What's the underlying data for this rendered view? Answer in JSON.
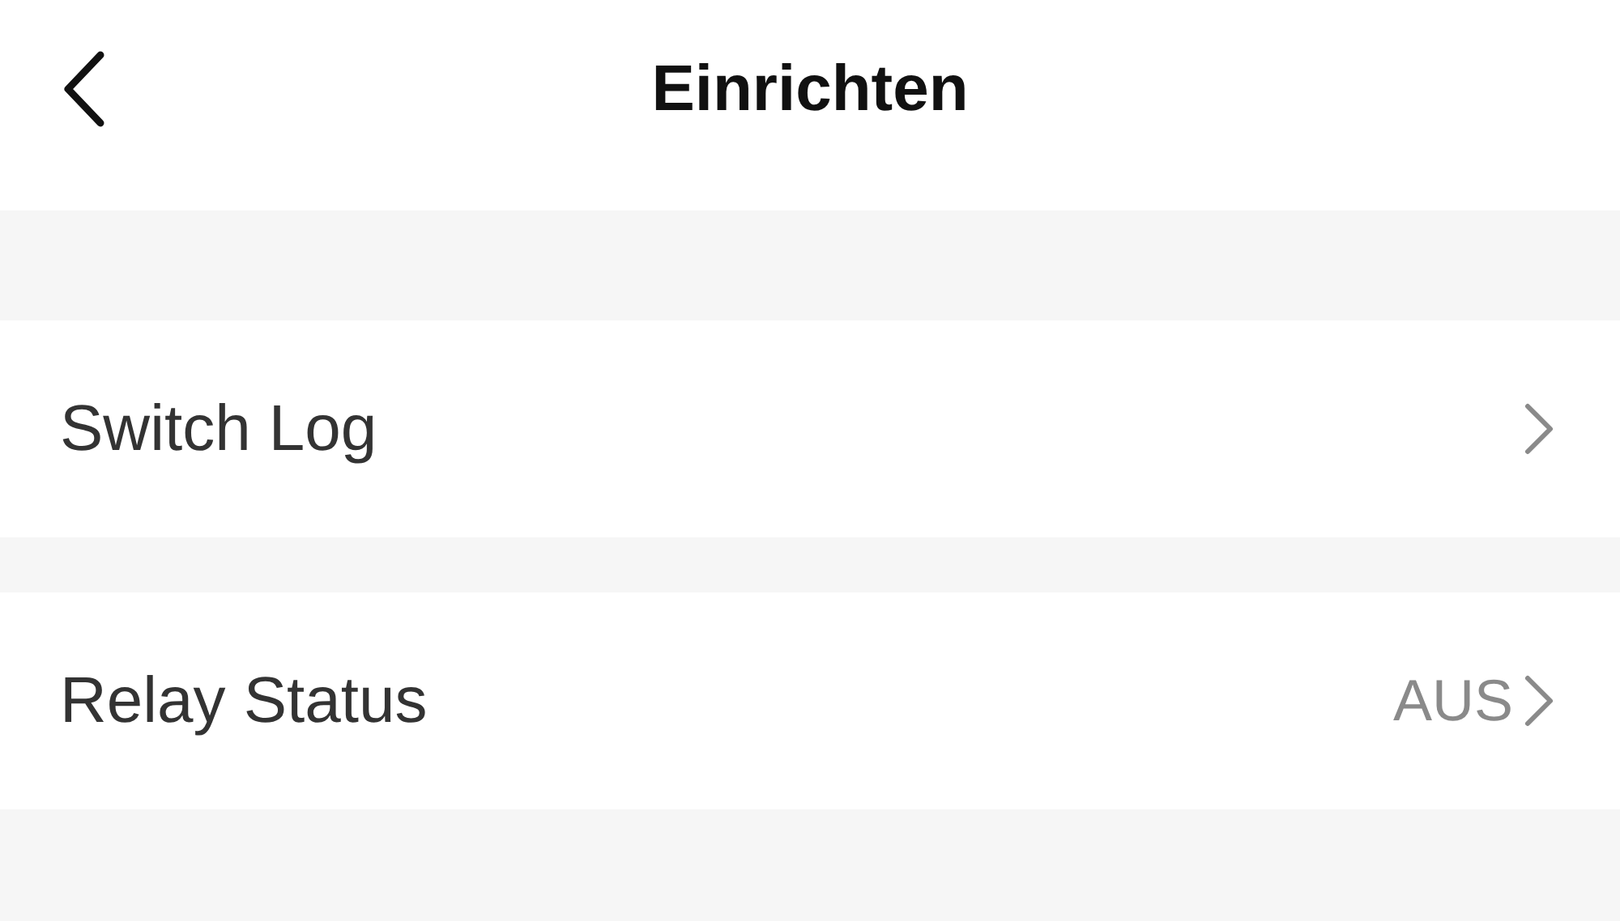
{
  "header": {
    "title": "Einrichten"
  },
  "rows": [
    {
      "label": "Switch Log"
    },
    {
      "label": "Relay Status",
      "value": "AUS"
    }
  ]
}
